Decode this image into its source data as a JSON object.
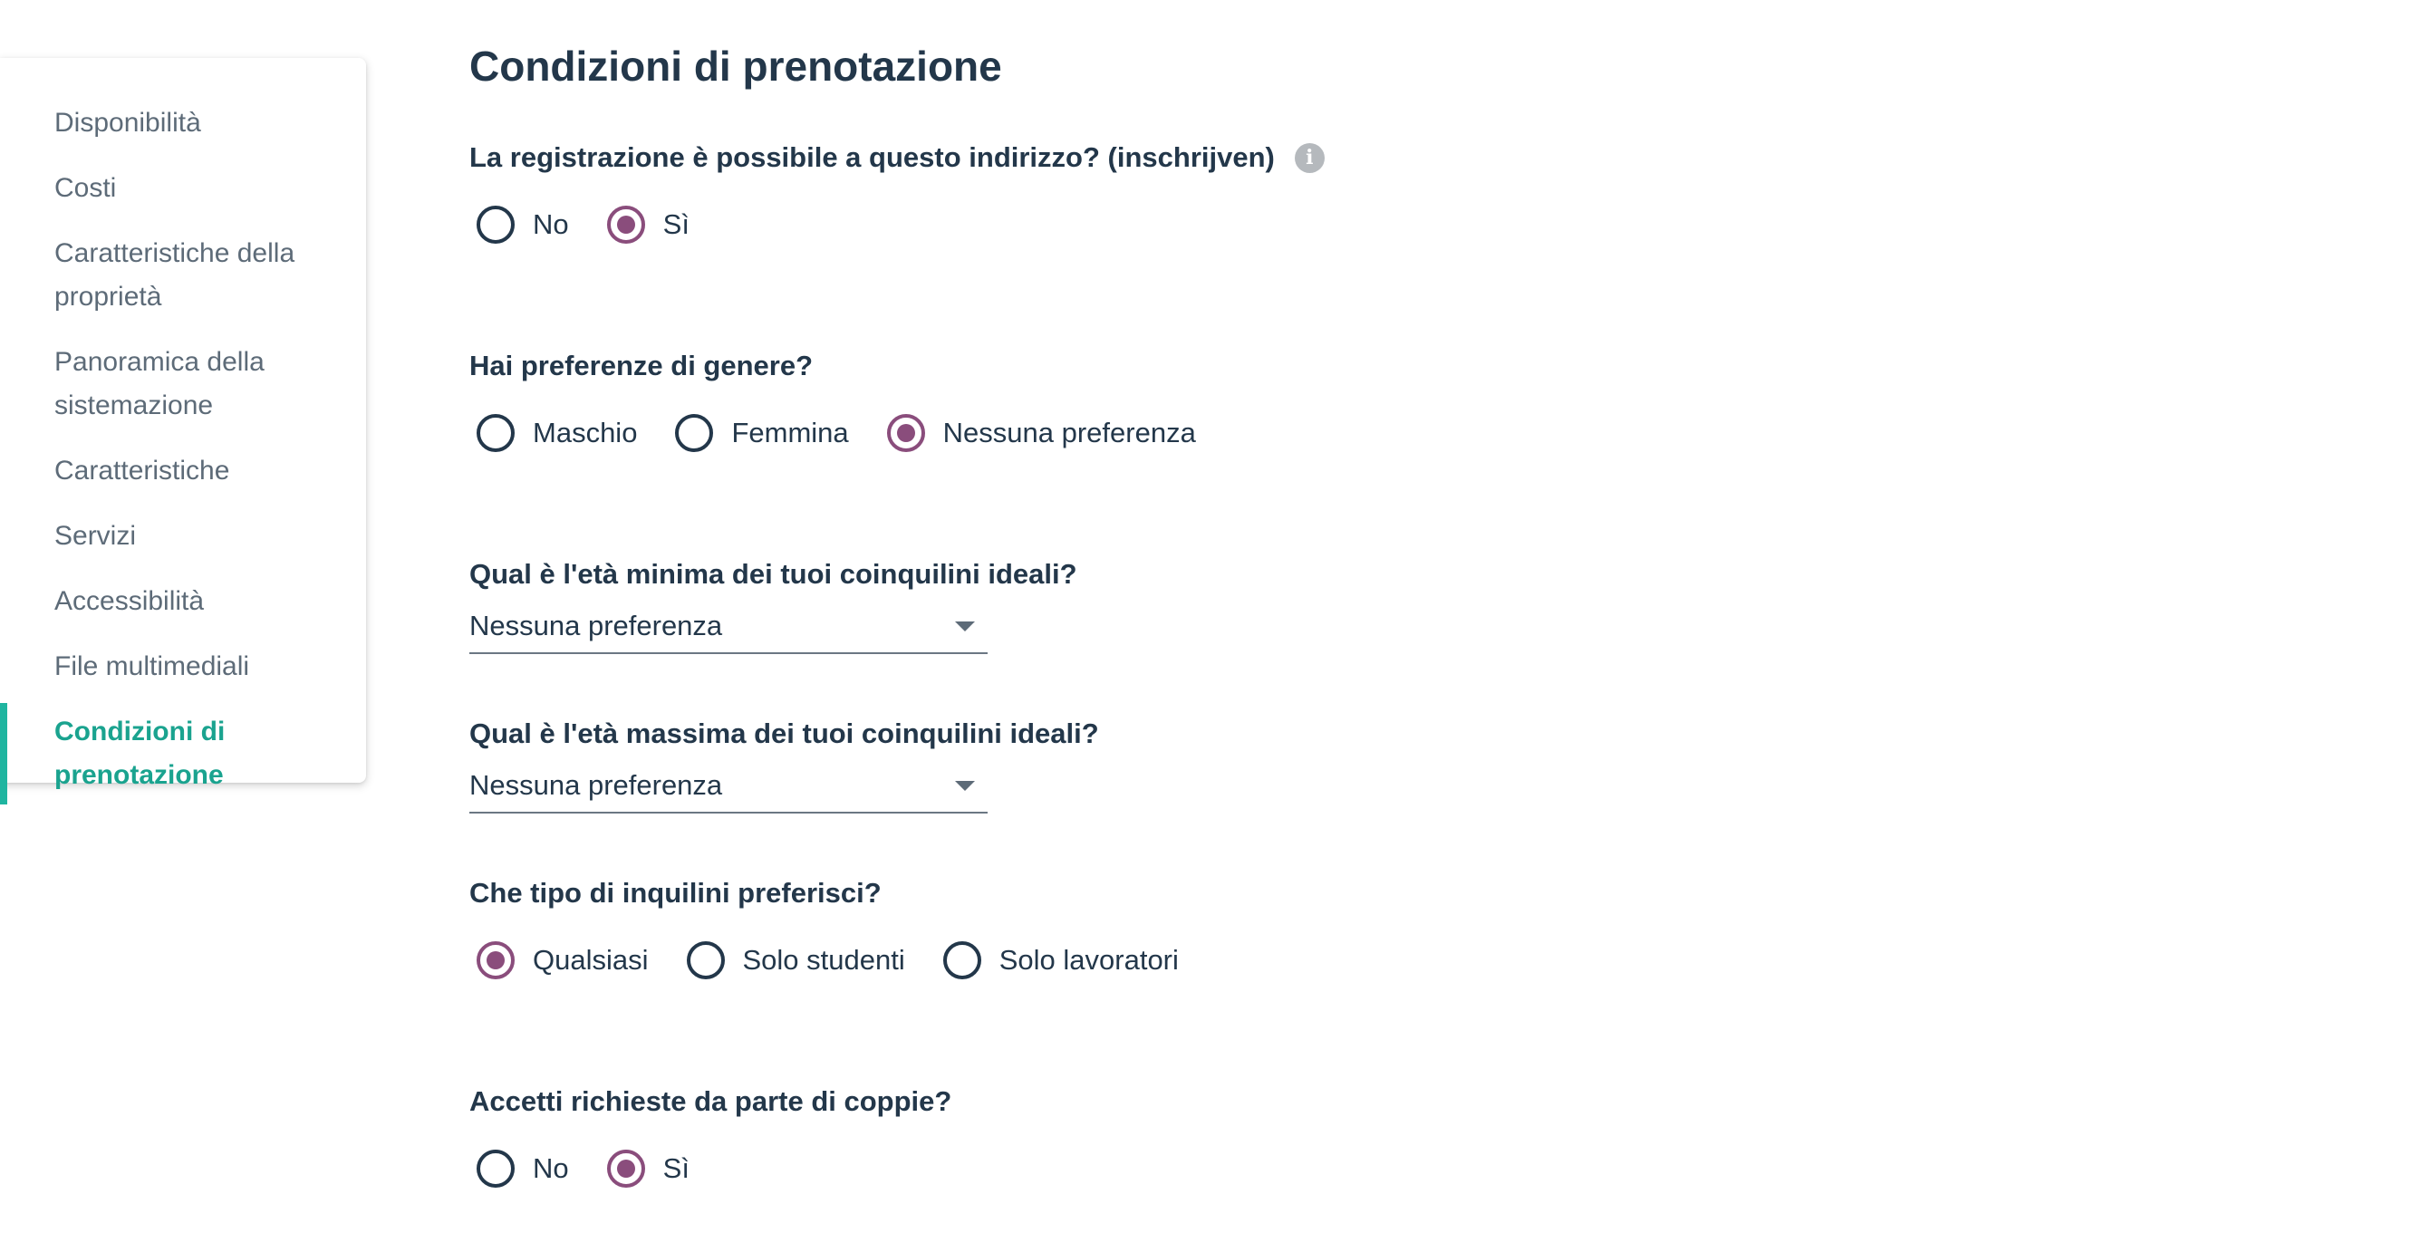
{
  "sidebar": {
    "items": [
      {
        "label": "Disponibilità"
      },
      {
        "label": "Costi"
      },
      {
        "label": "Caratteristiche della proprietà"
      },
      {
        "label": "Panoramica della sistemazione"
      },
      {
        "label": "Caratteristiche"
      },
      {
        "label": "Servizi"
      },
      {
        "label": "Accessibilità"
      },
      {
        "label": "File multimediali"
      },
      {
        "label": "Condizioni di prenotazione",
        "active": true
      }
    ]
  },
  "main": {
    "title": "Condizioni di prenotazione",
    "registration": {
      "question": "La registrazione è possibile a questo indirizzo? (inschrijven)",
      "info_icon": "info-icon",
      "options": [
        "No",
        "Sì"
      ],
      "selected": "Sì"
    },
    "gender": {
      "question": "Hai preferenze di genere?",
      "options": [
        "Maschio",
        "Femmina",
        "Nessuna preferenza"
      ],
      "selected": "Nessuna preferenza"
    },
    "min_age": {
      "question": "Qual è l'età minima dei tuoi coinquilini ideali?",
      "value": "Nessuna preferenza"
    },
    "max_age": {
      "question": "Qual è l'età massima dei tuoi coinquilini ideali?",
      "value": "Nessuna preferenza"
    },
    "tenant_type": {
      "question": "Che tipo di inquilini preferisci?",
      "options": [
        "Qualsiasi",
        "Solo studenti",
        "Solo lavoratori"
      ],
      "selected": "Qualsiasi"
    },
    "couples": {
      "question": "Accetti richieste da parte di coppie?",
      "options": [
        "No",
        "Sì"
      ],
      "selected": "Sì"
    }
  },
  "colors": {
    "accent_active": "#1aa38f",
    "radio_checked": "#8a4d7c",
    "text_dark": "#23374a",
    "text_muted": "#5d6b78"
  }
}
